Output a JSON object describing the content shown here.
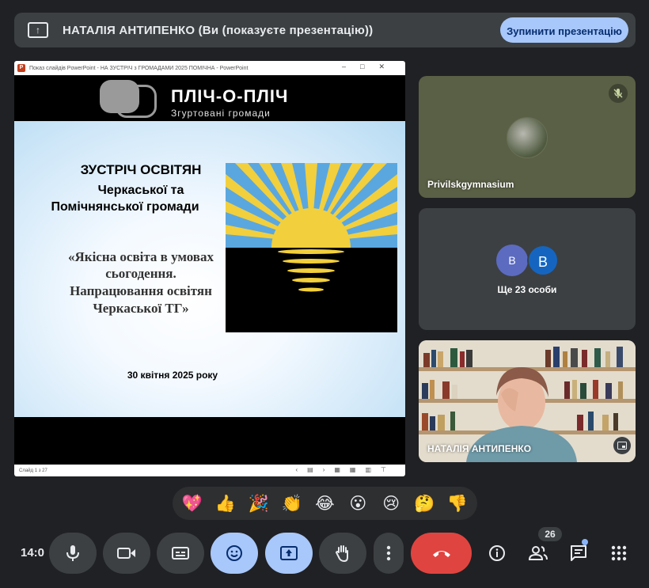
{
  "banner": {
    "presenting_text": "НАТАЛІЯ АНТИПЕНКО (Ви (показуєте презентацію))",
    "stop_button": "Зупинити презентацію"
  },
  "powerpoint": {
    "window_title": "Показ слайдів PowerPoint - НА ЗУСТРІЧ з ГРОМАДАМИ 2025 ПОМІЧНА - PowerPoint",
    "status_left": "Слайд 1 з 27",
    "slide": {
      "logo_text": "ПЛІЧ-О-ПЛІЧ",
      "logo_subtitle": "Згуртовані громади",
      "title": "ЗУСТРІЧ ОСВІТЯН",
      "subtitle_line1": "Черкаської та",
      "subtitle_line2": "Помічнянської громади",
      "quote_line1": "«Якісна освіта в умовах",
      "quote_line2": "сьогодення.",
      "quote_line3": "Напрацювання освітян",
      "quote_line4": "Черкаської ТГ»",
      "date": "30 квітня 2025 року"
    }
  },
  "tiles": {
    "participant1_name": "Privilskgymnasium",
    "group_avatar1": "В",
    "group_avatar2": "В",
    "more_people": "Ще 23 особи",
    "self_name": "НАТАЛІЯ АНТИПЕНКО"
  },
  "reactions": [
    "💖",
    "👍",
    "🎉",
    "👏",
    "😂",
    "😮",
    "😢",
    "🤔",
    "👎"
  ],
  "toolbar": {
    "clock": "14:0",
    "participants_count": "26"
  },
  "colors": {
    "background": "#202124",
    "surface": "#3c4043",
    "accent_blue": "#a8c7fa",
    "end_call_red": "#e04440"
  }
}
